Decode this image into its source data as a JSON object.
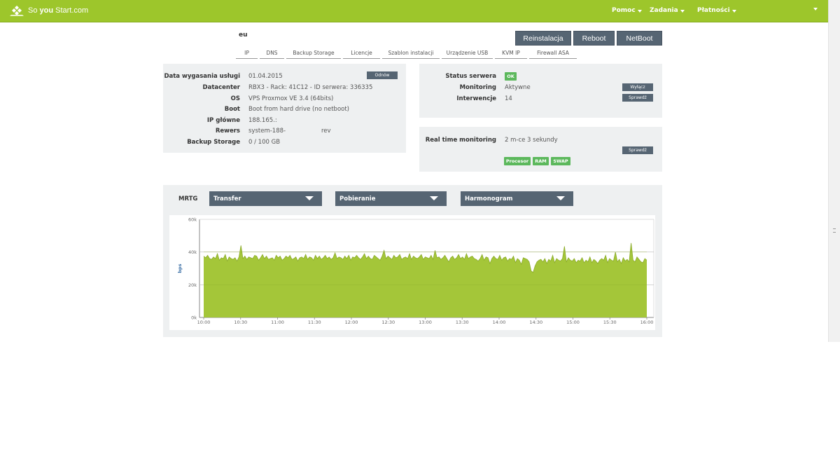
{
  "header": {
    "logo_pre": "So ",
    "logo_bold": "you",
    "logo_post": " Start",
    "logo_suffix": ".com",
    "nav": [
      {
        "label": "Pomoc"
      },
      {
        "label": "Zadania"
      },
      {
        "label": "Płatności"
      }
    ]
  },
  "server": {
    "name": "eu",
    "actions": [
      "Reinstalacja",
      "Reboot",
      "NetBoot"
    ]
  },
  "tabs": [
    "IP",
    "DNS",
    "Backup Storage",
    "Licencje",
    "Szablon instalacji",
    "Urządzenie USB",
    "KVM IP",
    "Firewall ASA"
  ],
  "info": {
    "rows": [
      {
        "label": "Data wygasania usługi",
        "value": "01.04.2015"
      },
      {
        "label": "Datacenter",
        "value": "RBX3 - Rack: 41C12 - ID serwera: 336335"
      },
      {
        "label": "OS",
        "value": "VPS Proxmox VE 3.4 (64bits)"
      },
      {
        "label": "Boot",
        "value": "Boot from hard drive (no netboot)"
      },
      {
        "label": "IP główne",
        "value": "188.165.:"
      },
      {
        "label": "Rewers",
        "value": "system-188-",
        "value2": "rev"
      },
      {
        "label": "Backup Storage",
        "value": "0 / 100 GB"
      }
    ],
    "renew_button": "Odnów"
  },
  "status": {
    "rows": [
      {
        "label": "Status serwera",
        "badge": "OK"
      },
      {
        "label": "Monitoring",
        "value": "Aktywne",
        "button": "Wyłącz"
      },
      {
        "label": "Interwencje",
        "value": "14",
        "button": "Sprawdź"
      }
    ],
    "colors": {
      "ok": "#5cb85c"
    }
  },
  "realtime": {
    "label": "Real time monitoring",
    "value": "2 m-ce 3 sekundy",
    "button": "Sprawdź",
    "tags": [
      "Procesor",
      "RAM",
      "SWAP"
    ]
  },
  "mrtg": {
    "label": "MRTG",
    "dropdowns": [
      "Transfer",
      "Pobieranie",
      "Harmonogram"
    ]
  },
  "chart_data": {
    "type": "area",
    "ylabel": "bps",
    "ylim": [
      0,
      60000
    ],
    "yticks": [
      "0k",
      "20k",
      "40k",
      "60k"
    ],
    "xticks": [
      "10:00",
      "10:30",
      "11:00",
      "11:30",
      "12:00",
      "12:30",
      "13:00",
      "13:30",
      "14:00",
      "14:30",
      "15:00",
      "15:30",
      "16:00"
    ],
    "x_start": "10:00",
    "x_end": "16:00",
    "fill_color": "#a4c639",
    "line_color": "#8bab2a",
    "values": [
      37500,
      36500,
      38000,
      36000,
      35500,
      37000,
      36000,
      39000,
      35000,
      36500,
      36000,
      38500,
      34500,
      37000,
      36000,
      35500,
      36500,
      34500,
      37000,
      44000,
      36000,
      37500,
      35500,
      37000,
      36500,
      36000,
      38000,
      37500,
      35000,
      36500,
      38500,
      36000,
      37500,
      35500,
      36000,
      36500,
      35000,
      38000,
      36500,
      37500,
      35000,
      36000,
      37500,
      36500,
      38000,
      35500,
      36000,
      37000,
      34500,
      36500,
      37000,
      36000,
      38500,
      35500,
      37000,
      36500,
      35000,
      38000,
      36000,
      37500,
      35500,
      36500,
      38000,
      36000,
      37000,
      35500,
      36500,
      39500,
      36000,
      37000,
      36500,
      35500,
      37500,
      36000,
      38000,
      35000,
      37000,
      36500,
      38000,
      36500,
      35500,
      37000,
      39000,
      36000,
      37500,
      36000,
      35500,
      38000,
      37000,
      36000,
      35000,
      37500,
      41000,
      36000,
      37500,
      36500,
      35500,
      38000,
      36500,
      37000,
      38500,
      35500,
      36500,
      37000,
      36000,
      39000,
      35500,
      37500,
      36500,
      36000,
      37000,
      38500,
      35500,
      37000,
      36500,
      36000,
      38000,
      35500,
      41000,
      36500,
      37000,
      35500,
      36500,
      38000,
      36000,
      34000,
      36500,
      37500,
      35500,
      36500,
      38500,
      36000,
      37000,
      35500,
      39000,
      36000,
      37000,
      37500,
      36000,
      35500,
      34500,
      36000,
      38500,
      35000,
      37000,
      36500,
      33000,
      36000,
      37500,
      36000,
      35500,
      38000,
      35000,
      36500,
      37000,
      34500,
      36000,
      35500,
      37500,
      33500,
      36000,
      35000,
      32500,
      36500,
      36000,
      35500,
      34000,
      28500,
      27500,
      31500,
      34000,
      35000,
      35500,
      34000,
      36000,
      33000,
      35500,
      34500,
      38000,
      33500,
      36000,
      35000,
      34500,
      36000,
      43500,
      34000,
      36500,
      35000,
      34500,
      36000,
      33500,
      35000,
      34500,
      36500,
      33500,
      35000,
      34000,
      37000,
      33500,
      35500,
      34500,
      33000,
      35000,
      36000,
      35000,
      38000,
      33500,
      36000,
      35000,
      34500,
      40000,
      34000,
      35500,
      33000,
      36500,
      34500,
      35500,
      34000,
      45500,
      35000,
      34000,
      37000,
      35500,
      34000,
      33500,
      36000,
      35000
    ]
  }
}
